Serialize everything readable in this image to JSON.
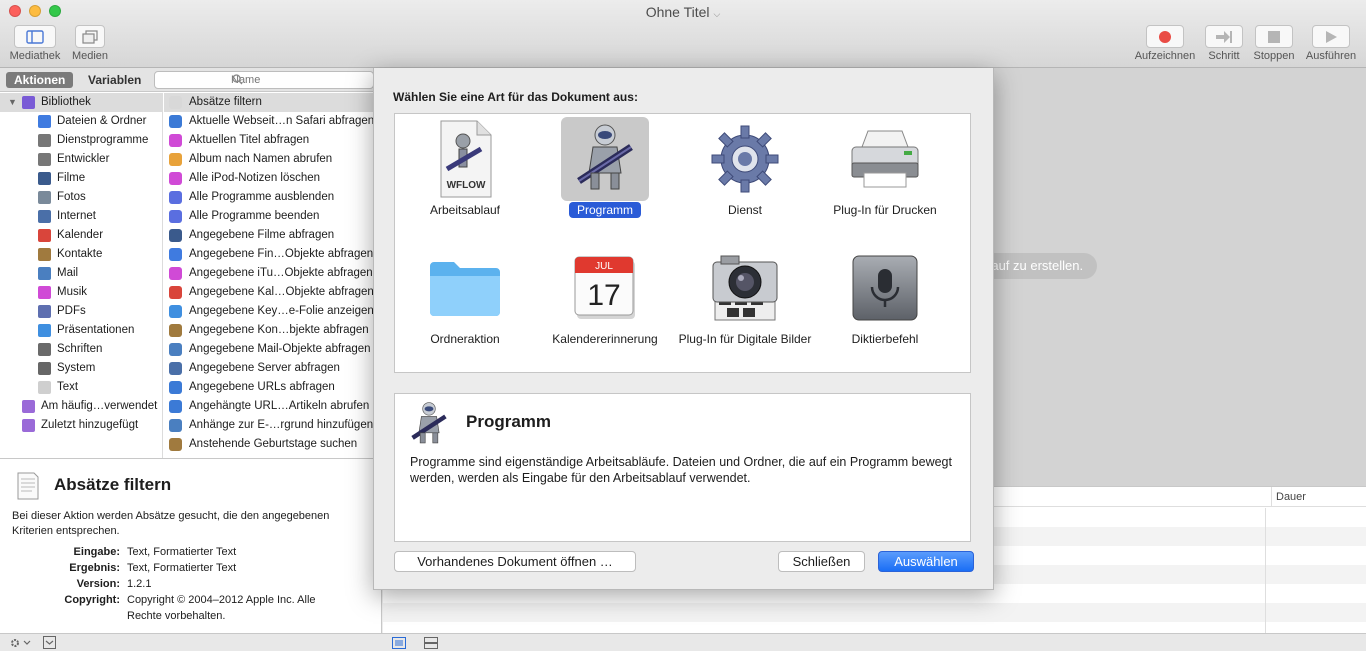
{
  "window": {
    "title": "Ohne Titel"
  },
  "toolbar": {
    "left": [
      {
        "label": "Mediathek",
        "icon": "library-icon"
      },
      {
        "label": "Medien",
        "icon": "media-icon"
      }
    ],
    "right": [
      {
        "label": "Aufzeichnen",
        "icon": "record-icon"
      },
      {
        "label": "Schritt",
        "icon": "step-icon"
      },
      {
        "label": "Stoppen",
        "icon": "stop-icon"
      },
      {
        "label": "Ausführen",
        "icon": "run-icon"
      }
    ]
  },
  "library": {
    "tab_actions": "Aktionen",
    "tab_variables": "Variablen",
    "search_placeholder": "Name",
    "categories": [
      {
        "label": "Bibliothek",
        "level": 0,
        "color": "#7a5bd6"
      },
      {
        "label": "Dateien & Ordner",
        "level": 1,
        "color": "#3f7be0"
      },
      {
        "label": "Dienstprogramme",
        "level": 1,
        "color": "#777777"
      },
      {
        "label": "Entwickler",
        "level": 1,
        "color": "#777777"
      },
      {
        "label": "Filme",
        "level": 1,
        "color": "#3a5a8c"
      },
      {
        "label": "Fotos",
        "level": 1,
        "color": "#7a8a9a"
      },
      {
        "label": "Internet",
        "level": 1,
        "color": "#4a6fa8"
      },
      {
        "label": "Kalender",
        "level": 1,
        "color": "#d9453b"
      },
      {
        "label": "Kontakte",
        "level": 1,
        "color": "#a07a3e"
      },
      {
        "label": "Mail",
        "level": 1,
        "color": "#4a7fc0"
      },
      {
        "label": "Musik",
        "level": 1,
        "color": "#d04ad6"
      },
      {
        "label": "PDFs",
        "level": 1,
        "color": "#5e6fb0"
      },
      {
        "label": "Präsentationen",
        "level": 1,
        "color": "#3f8fe0"
      },
      {
        "label": "Schriften",
        "level": 1,
        "color": "#6a6a6a"
      },
      {
        "label": "System",
        "level": 1,
        "color": "#666666"
      },
      {
        "label": "Text",
        "level": 1,
        "color": "#cfcfcf"
      },
      {
        "label": "Am häufig…verwendet",
        "level": 0,
        "color": "#9a6ad8"
      },
      {
        "label": "Zuletzt hinzugefügt",
        "level": 0,
        "color": "#9a6ad8"
      }
    ],
    "actions": [
      {
        "label": "Absätze filtern",
        "color": "#d8d8d8"
      },
      {
        "label": "Aktuelle Webseit…n Safari abfragen",
        "color": "#3b7ad6"
      },
      {
        "label": "Aktuellen Titel abfragen",
        "color": "#d04ad6"
      },
      {
        "label": "Album nach Namen abrufen",
        "color": "#e8a23a"
      },
      {
        "label": "Alle iPod-Notizen löschen",
        "color": "#d04ad6"
      },
      {
        "label": "Alle Programme ausblenden",
        "color": "#5a6ee0"
      },
      {
        "label": "Alle Programme beenden",
        "color": "#5a6ee0"
      },
      {
        "label": "Angegebene Filme abfragen",
        "color": "#3a5a8c"
      },
      {
        "label": "Angegebene Fin…Objekte abfragen",
        "color": "#3f7be0"
      },
      {
        "label": "Angegebene iTu…Objekte abfragen",
        "color": "#d04ad6"
      },
      {
        "label": "Angegebene Kal…Objekte abfragen",
        "color": "#d9453b"
      },
      {
        "label": "Angegebene Key…e-Folie anzeigen",
        "color": "#3f8fe0"
      },
      {
        "label": "Angegebene Kon…bjekte abfragen",
        "color": "#a07a3e"
      },
      {
        "label": "Angegebene Mail-Objekte abfragen",
        "color": "#4a7fc0"
      },
      {
        "label": "Angegebene Server abfragen",
        "color": "#4a6fa8"
      },
      {
        "label": "Angegebene URLs abfragen",
        "color": "#3b7ad6"
      },
      {
        "label": "Angehängte URL…Artikeln abrufen",
        "color": "#3b7ad6"
      },
      {
        "label": "Anhänge zur E-…rgrund hinzufügen",
        "color": "#4a7fc0"
      },
      {
        "label": "Anstehende Geburtstage suchen",
        "color": "#a07a3e"
      }
    ]
  },
  "description": {
    "title": "Absätze filtern",
    "text": "Bei dieser Aktion werden Absätze gesucht, die den angegebenen Kriterien entsprechen.",
    "meta": [
      {
        "key": "Eingabe:",
        "value": "Text, Formatierter Text"
      },
      {
        "key": "Ergebnis:",
        "value": "Text, Formatierter Text"
      },
      {
        "key": "Version:",
        "value": "1.2.1"
      },
      {
        "key": "Copyright:",
        "value": "Copyright © 2004–2012 Apple Inc. Alle Rechte vorbehalten."
      }
    ]
  },
  "workflow": {
    "hint": "ablauf zu erstellen.",
    "log_column": "Dauer"
  },
  "sheet": {
    "prompt": "Wählen Sie eine Art für das Dokument aus:",
    "types": [
      {
        "label": "Arbeitsablauf",
        "icon": "workflow-document-icon"
      },
      {
        "label": "Programm",
        "icon": "automator-robot-icon",
        "selected": true
      },
      {
        "label": "Dienst",
        "icon": "gear-icon"
      },
      {
        "label": "Plug-In für Drucken",
        "icon": "printer-icon"
      },
      {
        "label": "Ordneraktion",
        "icon": "folder-icon"
      },
      {
        "label": "Kalendererinnerung",
        "icon": "calendar-icon",
        "calendar_month": "JUL",
        "calendar_day": "17"
      },
      {
        "label": "Plug-In für Digitale Bilder",
        "icon": "camera-icon"
      },
      {
        "label": "Diktierbefehl",
        "icon": "microphone-icon"
      }
    ],
    "workflow_badge": "WFLOW",
    "info_title": "Programm",
    "info_text": "Programme sind eigenständige Arbeitsabläufe. Dateien und Ordner, die auf ein Programm bewegt werden, werden als Eingabe für den Arbeitsablauf verwendet.",
    "button_open": "Vorhandenes Dokument öffnen …",
    "button_close": "Schließen",
    "button_choose": "Auswählen"
  }
}
